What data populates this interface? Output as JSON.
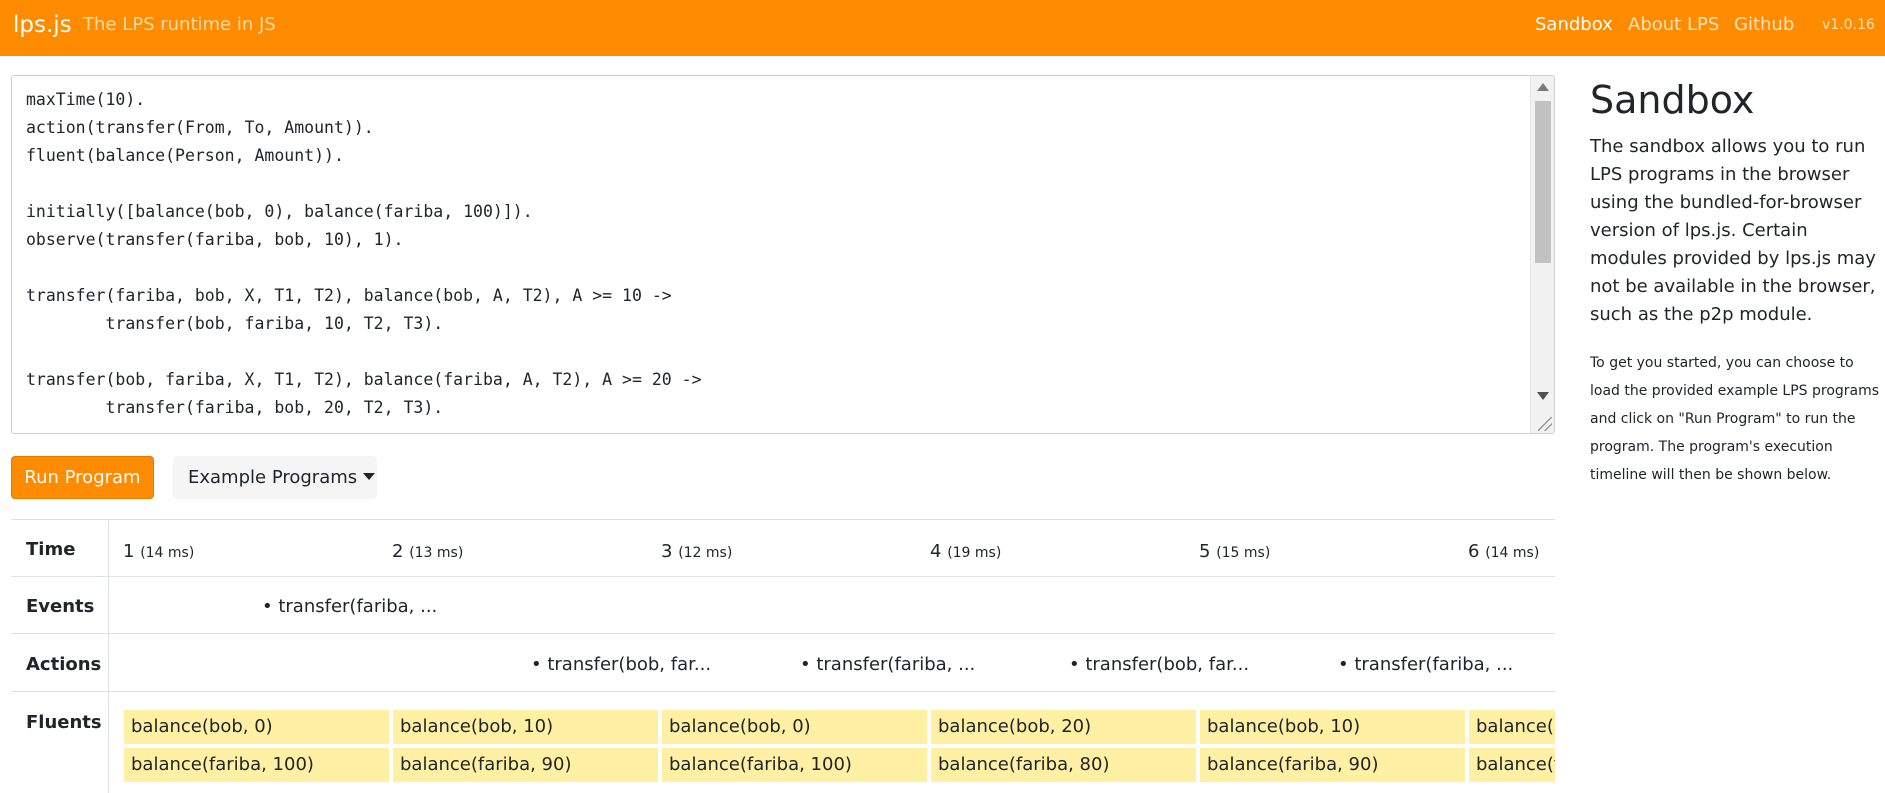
{
  "navbar": {
    "brand": "lps.js",
    "tagline": "The LPS runtime in JS",
    "links": {
      "sandbox": "Sandbox",
      "about": "About LPS",
      "github": "Github"
    },
    "version": "v1.0.16",
    "accent_color": "#ff8c00"
  },
  "editor": {
    "code": "maxTime(10).\naction(transfer(From, To, Amount)).\nfluent(balance(Person, Amount)).\n\ninitially([balance(bob, 0), balance(fariba, 100)]).\nobserve(transfer(fariba, bob, 10), 1).\n\ntransfer(fariba, bob, X, T1, T2), balance(bob, A, T2), A >= 10 ->\n        transfer(bob, fariba, 10, T2, T3).\n\ntransfer(bob, fariba, X, T1, T2), balance(fariba, A, T2), A >= 20 ->\n        transfer(fariba, bob, 20, T2, T3)."
  },
  "buttons": {
    "run": "Run Program",
    "examples": "Example Programs"
  },
  "timeline": {
    "labels": {
      "time": "Time",
      "events": "Events",
      "actions": "Actions",
      "fluents": "Fluents"
    },
    "ticks": [
      {
        "n": "1",
        "ms": "(14 ms)"
      },
      {
        "n": "2",
        "ms": "(13 ms)"
      },
      {
        "n": "3",
        "ms": "(12 ms)"
      },
      {
        "n": "4",
        "ms": "(19 ms)"
      },
      {
        "n": "5",
        "ms": "(15 ms)"
      },
      {
        "n": "6",
        "ms": "(14 ms)"
      }
    ],
    "events": [
      "• transfer(fariba, ..."
    ],
    "actions": [
      "• transfer(bob, far...",
      "• transfer(fariba, ...",
      "• transfer(bob, far...",
      "• transfer(fariba, ..."
    ],
    "fluents_top": [
      "balance(bob, 0)",
      "balance(bob, 10)",
      "balance(bob, 0)",
      "balance(bob, 20)",
      "balance(bob, 10)",
      "balance(b"
    ],
    "fluents_bottom": [
      "balance(fariba, 100)",
      "balance(fariba, 90)",
      "balance(fariba, 100)",
      "balance(fariba, 80)",
      "balance(fariba, 90)",
      "balance(f"
    ],
    "fluent_color": "#fff0a3"
  },
  "sidebar": {
    "title": "Sandbox",
    "description": "The sandbox allows you to run LPS programs in the browser using the bundled-for-browser version of lps.js. Certain modules provided by lps.js may not be available in the browser, such as the p2p module.",
    "help": "To get you started, you can choose to load the provided example LPS programs and click on \"Run Program\" to run the program. The program's execution timeline will then be shown below."
  }
}
